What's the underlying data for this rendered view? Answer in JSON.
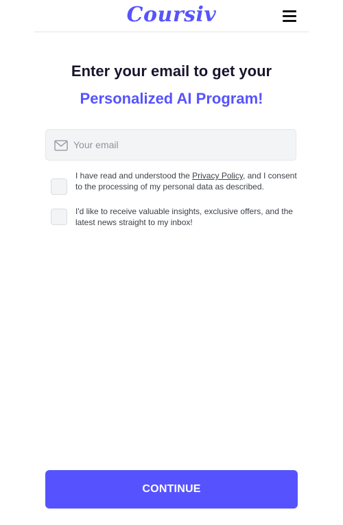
{
  "colors": {
    "brand": "#5653fe",
    "title": "#17152b",
    "background": "#ffffff",
    "input_bg": "#f3f4f6",
    "button_text": "#ffffff"
  },
  "header": {
    "logo_text": "Coursiv",
    "menu_icon": "hamburger-menu-icon"
  },
  "main": {
    "title_line1": "Enter your email to get your",
    "title_line2": "Personalized AI Program!",
    "email": {
      "icon": "envelope-icon",
      "placeholder": "Your email",
      "value": ""
    },
    "consents": [
      {
        "checked": false,
        "text_before": "I have read and understood the ",
        "link_text": "Privacy Policy",
        "text_after": ", and I consent to the processing of my personal data as described."
      },
      {
        "checked": false,
        "text": "I'd like to receive valuable insights, exclusive offers, and the latest news straight to my inbox!"
      }
    ],
    "continue_label": "CONTINUE"
  }
}
